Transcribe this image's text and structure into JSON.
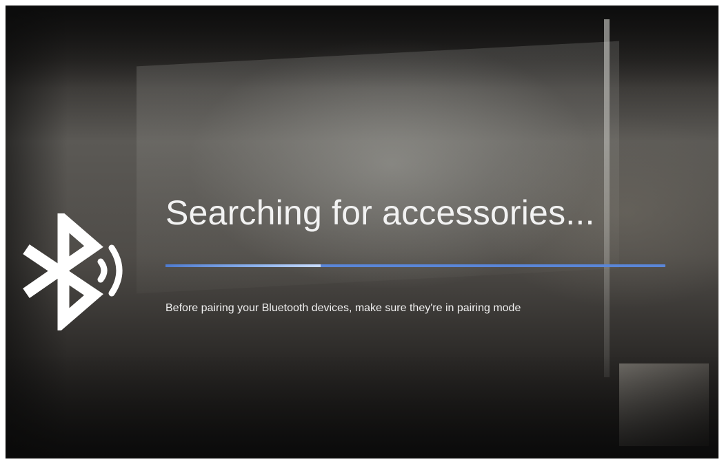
{
  "screen": {
    "title": "Searching for accessories...",
    "subtitle": "Before pairing your Bluetooth devices, make sure they're in pairing mode",
    "icon": "bluetooth-searching-icon",
    "progress": {
      "state": "indeterminate",
      "track_color": "#5a86d8",
      "highlight_color": "#c9dcff"
    }
  }
}
